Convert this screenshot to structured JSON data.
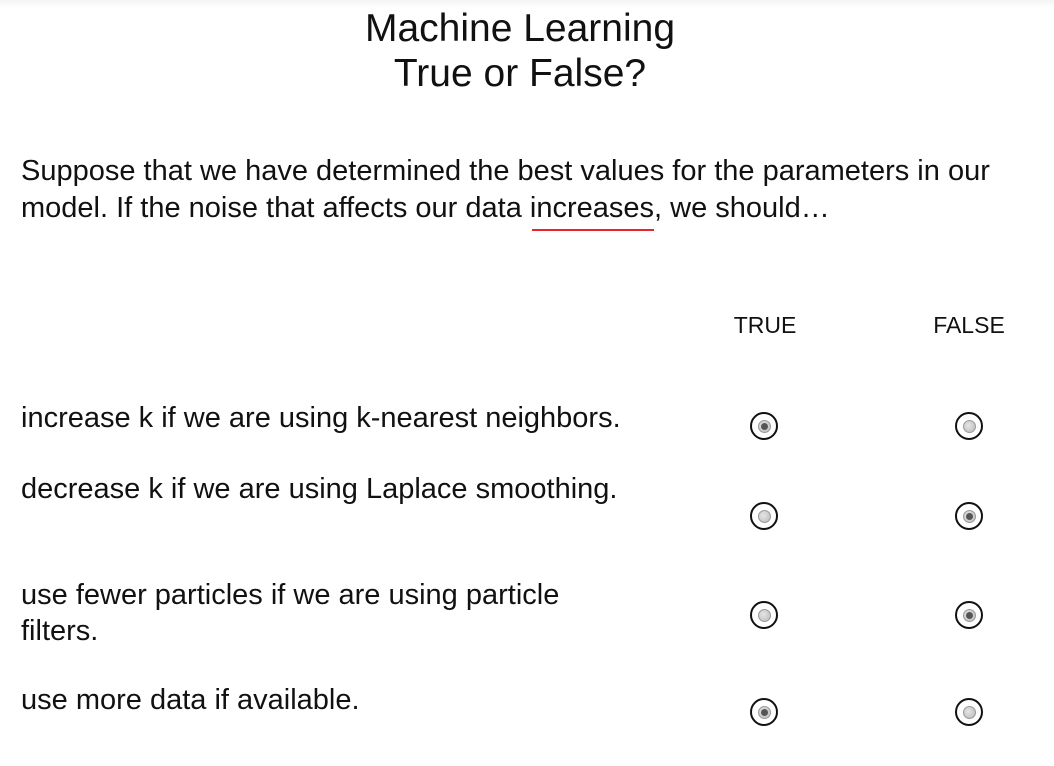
{
  "title": {
    "line1": "Machine Learning",
    "line2": "True or False?"
  },
  "question": {
    "before": "Suppose that we have determined the best values for the parameters in our model. If the noise that affects our data ",
    "highlight": "increases",
    "after": ", we should…",
    "highlight_underline_color": "#e8242c"
  },
  "columns": {
    "true_label": "TRUE",
    "false_label": "FALSE"
  },
  "statements": [
    {
      "text": "increase k if we are using k-nearest neighbors.",
      "selected": "TRUE"
    },
    {
      "text": "decrease k if we are using Laplace smoothing.",
      "selected": "FALSE"
    },
    {
      "text": "use fewer particles if we are using particle filters.",
      "selected": "FALSE"
    },
    {
      "text": "use more data if available.",
      "selected": "TRUE"
    }
  ],
  "icons": {
    "radio_unselected": "radio-unselected-icon",
    "radio_selected": "radio-selected-icon"
  }
}
